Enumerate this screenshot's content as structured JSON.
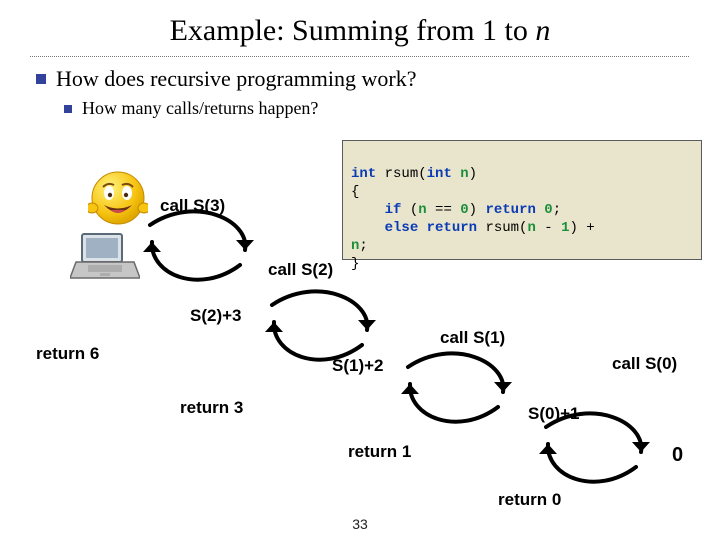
{
  "title_plain": "Example: Summing from 1 to ",
  "title_em": "n",
  "bullet1": "How does recursive programming work?",
  "bullet2": "How many calls/returns happen?",
  "code": {
    "sig": [
      "int",
      " rsum(",
      "int",
      " ",
      "n",
      ")"
    ],
    "open": "{",
    "l1a": "    ",
    "l1_if": "if",
    "l1b": " (",
    "l1_n": "n",
    "l1c": " == ",
    "l1_z": "0",
    "l1d": ") ",
    "l1_ret": "return",
    "l1e": " ",
    "l1_z2": "0",
    "l1f": ";",
    "l2a": "    ",
    "l2_else": "else",
    "l2b": " ",
    "l2_ret": "return",
    "l2c": " rsum(",
    "l2_n": "n",
    "l2d": " - ",
    "l2_one": "1",
    "l2e": ") + ",
    "l3_n": "n",
    "l3a": ";",
    "close": "}"
  },
  "labels": {
    "call_s3": "call S(3)",
    "call_s2": "call S(2)",
    "call_s1": "call S(1)",
    "call_s0": "call S(0)",
    "ret6": "return 6",
    "ret3": "return 3",
    "ret1": "return 1",
    "ret0": "return 0",
    "s2p3": "S(2)+3",
    "s1p2": "S(1)+2",
    "s0p1": "S(0)+1",
    "zero": "0"
  },
  "pagenum": "33"
}
